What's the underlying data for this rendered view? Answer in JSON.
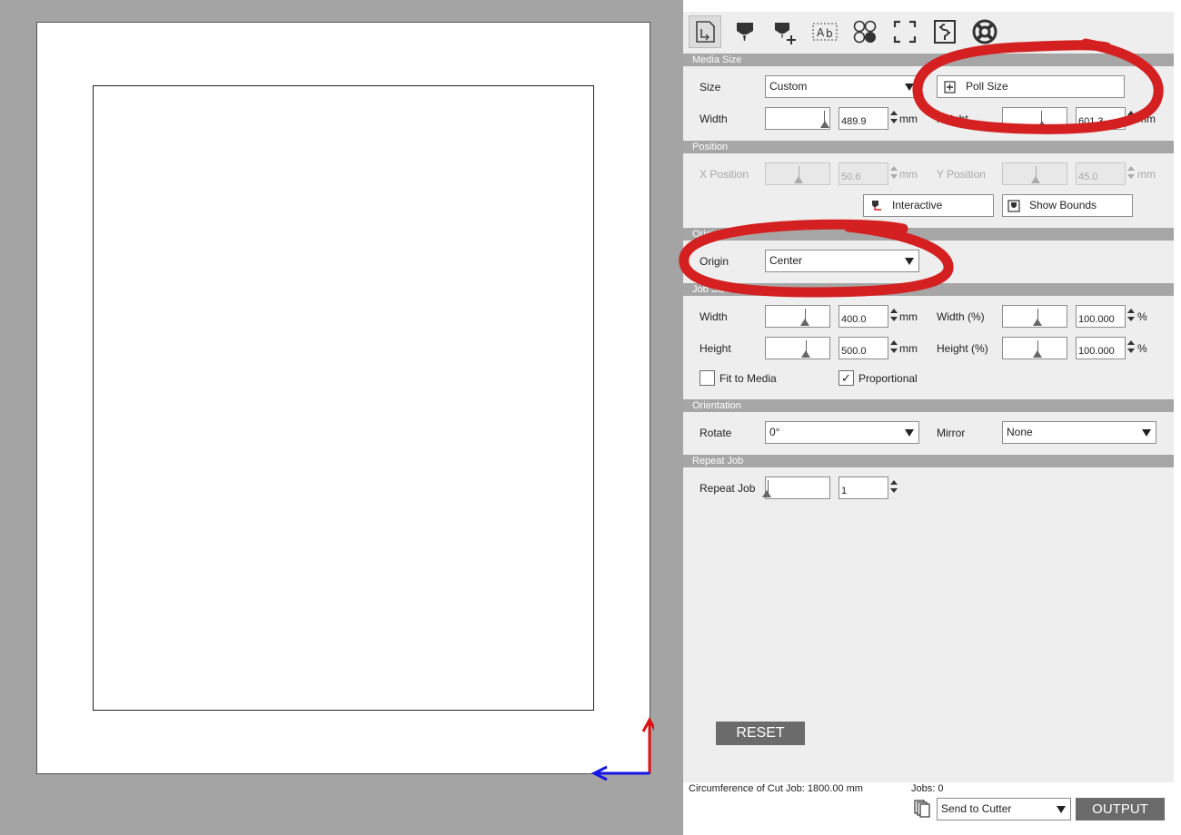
{
  "toolbar": {
    "tools": [
      "media-icon",
      "cut-tool-icon",
      "add-tool-icon",
      "text-weld-icon",
      "circles-icon",
      "fullscreen-icon",
      "registration-icon",
      "help-lifebuoy-icon"
    ]
  },
  "sections": {
    "media_size": "Media Size",
    "position": "Position",
    "origin": "Origin",
    "job_size": "Job Size",
    "orientation": "Orientation",
    "repeat_job": "Repeat Job"
  },
  "media_size": {
    "size_label": "Size",
    "size_value": "Custom",
    "poll_size_label": "Poll Size",
    "width_label": "Width",
    "width_value": "489.9",
    "width_unit": "mm",
    "height_label": "Height",
    "height_value": "601.3",
    "height_unit": "mm"
  },
  "position": {
    "x_label": "X Position",
    "x_value": "50.6",
    "x_unit": "mm",
    "y_label": "Y Position",
    "y_value": "45.0",
    "y_unit": "mm",
    "interactive_label": "Interactive",
    "show_bounds_label": "Show Bounds"
  },
  "origin": {
    "label": "Origin",
    "value": "Center"
  },
  "job_size": {
    "width_label": "Width",
    "width_value": "400.0",
    "width_unit": "mm",
    "height_label": "Height",
    "height_value": "500.0",
    "height_unit": "mm",
    "width_pct_label": "Width (%)",
    "width_pct_value": "100.000",
    "height_pct_label": "Height (%)",
    "height_pct_value": "100.000",
    "pct_unit": "%",
    "fit_to_media_label": "Fit to Media",
    "fit_to_media_checked": false,
    "proportional_label": "Proportional",
    "proportional_checked": true,
    "proportional_mark": "✓"
  },
  "orientation": {
    "rotate_label": "Rotate",
    "rotate_value": "0°",
    "mirror_label": "Mirror",
    "mirror_value": "None"
  },
  "repeat_job": {
    "label": "Repeat Job",
    "value": "1"
  },
  "actions": {
    "reset_label": "RESET",
    "output_label": "OUTPUT"
  },
  "footer": {
    "circumference": "Circumference of Cut Job: 1800.00 mm",
    "jobs": "Jobs: 0",
    "send_target": "Send to Cutter"
  },
  "colors": {
    "annotation_red": "#d42020",
    "origin_x_arrow": "#1515e6",
    "origin_y_arrow": "#e01010",
    "section_header": "#a6a6a6",
    "panel_bg": "#eeeeee"
  }
}
